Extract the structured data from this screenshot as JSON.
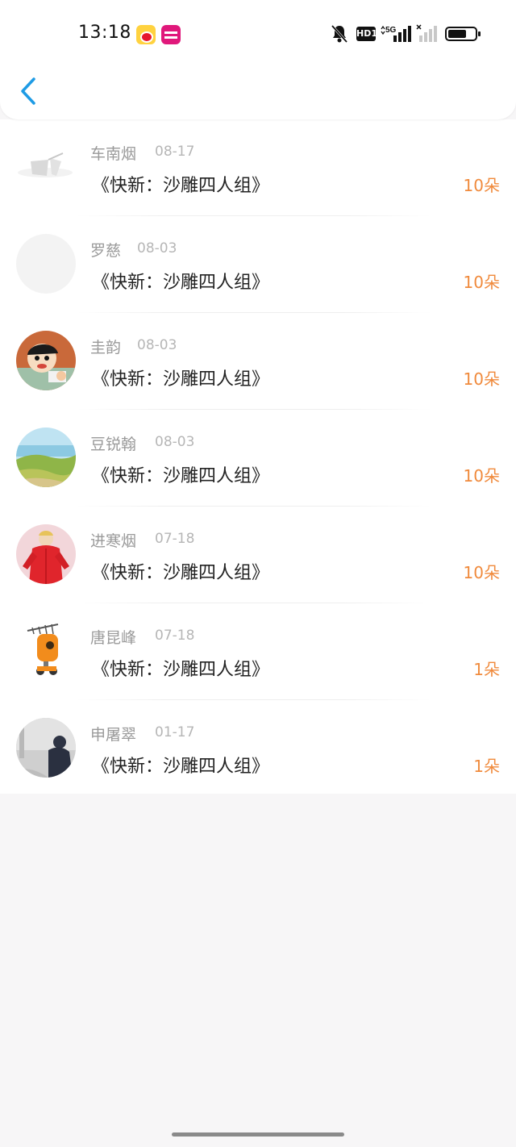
{
  "status_bar": {
    "time": "13:18",
    "hd_label": "HD1",
    "network": "5G",
    "icons": [
      "weibo-app-icon",
      "shop-app-icon",
      "bell-muted-icon",
      "hd-icon",
      "signal-5g-icon",
      "signal-icon",
      "battery-icon"
    ]
  },
  "nav": {
    "back_icon": "chevron-left-icon",
    "accent_color": "#1e9be5"
  },
  "colors": {
    "amount": "#f08a3c",
    "name": "#9a9a9a",
    "date": "#b6b6b6",
    "title": "#222222"
  },
  "gifts": [
    {
      "name": "车南烟",
      "date": "08-17",
      "title": "《快新：沙雕四人组》",
      "amount": "10朵",
      "avatar": "sketch-avatar"
    },
    {
      "name": "罗慈",
      "date": "08-03",
      "title": "《快新：沙雕四人组》",
      "amount": "10朵",
      "avatar": "blank-avatar"
    },
    {
      "name": "圭韵",
      "date": "08-03",
      "title": "《快新：沙雕四人组》",
      "amount": "10朵",
      "avatar": "cartoon-avatar"
    },
    {
      "name": "豆锐翰",
      "date": "08-03",
      "title": "《快新：沙雕四人组》",
      "amount": "10朵",
      "avatar": "landscape-avatar"
    },
    {
      "name": "进寒烟",
      "date": "07-18",
      "title": "《快新：沙雕四人组》",
      "amount": "10朵",
      "avatar": "red-outfit-avatar"
    },
    {
      "name": "唐昆峰",
      "date": "07-18",
      "title": "《快新：沙雕四人组》",
      "amount": "1朵",
      "avatar": "robot-avatar"
    },
    {
      "name": "申屠翠",
      "date": "01-17",
      "title": "《快新：沙雕四人组》",
      "amount": "1朵",
      "avatar": "misty-figure-avatar"
    }
  ]
}
